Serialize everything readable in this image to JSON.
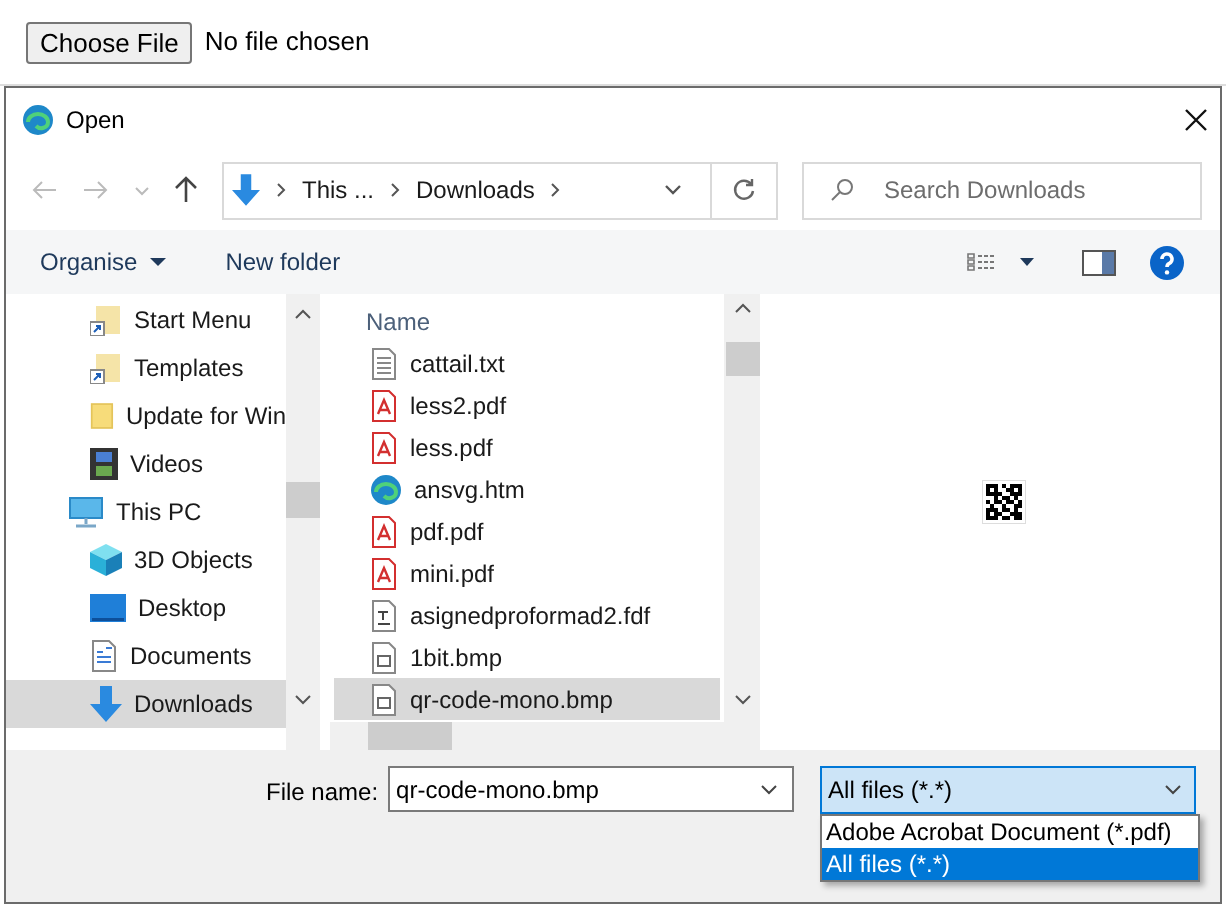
{
  "page": {
    "choose_button": "Choose File",
    "status": "No file chosen"
  },
  "dialog": {
    "title": "Open",
    "address": {
      "crumbs": [
        "This ...",
        "Downloads"
      ]
    },
    "search": {
      "placeholder": "Search Downloads"
    },
    "toolbar": {
      "organise": "Organise",
      "new_folder": "New folder"
    },
    "nav_pane": {
      "items": [
        {
          "label": "Start Menu",
          "kind": "shortcut",
          "selected": false
        },
        {
          "label": "Templates",
          "kind": "shortcut",
          "selected": false
        },
        {
          "label": "Update for Win",
          "kind": "folder",
          "selected": false
        },
        {
          "label": "Videos",
          "kind": "videos",
          "selected": false
        },
        {
          "label": "This PC",
          "kind": "pc",
          "selected": false
        },
        {
          "label": "3D Objects",
          "kind": "cube",
          "selected": false
        },
        {
          "label": "Desktop",
          "kind": "desktop",
          "selected": false
        },
        {
          "label": "Documents",
          "kind": "documents",
          "selected": false
        },
        {
          "label": "Downloads",
          "kind": "downloads",
          "selected": true
        }
      ]
    },
    "file_list": {
      "column": "Name",
      "files": [
        {
          "name": "cattail.txt",
          "kind": "text",
          "selected": false
        },
        {
          "name": "less2.pdf",
          "kind": "pdf",
          "selected": false
        },
        {
          "name": "less.pdf",
          "kind": "pdf",
          "selected": false
        },
        {
          "name": "ansvg.htm",
          "kind": "web",
          "selected": false
        },
        {
          "name": "pdf.pdf",
          "kind": "pdf",
          "selected": false
        },
        {
          "name": "mini.pdf",
          "kind": "pdf",
          "selected": false
        },
        {
          "name": "asignedproformad2.fdf",
          "kind": "form",
          "selected": false
        },
        {
          "name": "1bit.bmp",
          "kind": "image",
          "selected": false
        },
        {
          "name": "qr-code-mono.bmp",
          "kind": "image",
          "selected": true
        }
      ]
    },
    "file_name": {
      "label": "File name:",
      "value": "qr-code-mono.bmp"
    },
    "file_type": {
      "value": "All files (*.*)",
      "options": [
        {
          "label": "Adobe Acrobat Document (*.pdf)",
          "selected": false
        },
        {
          "label": "All files (*.*)",
          "selected": true
        }
      ]
    }
  }
}
